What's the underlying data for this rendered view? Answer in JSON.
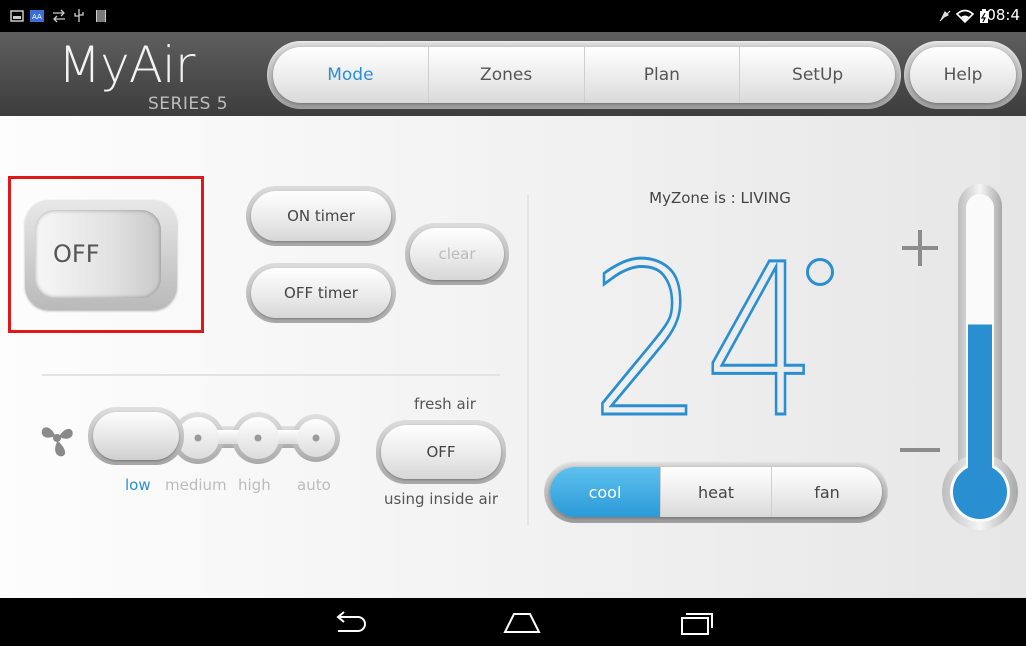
{
  "status_bar": {
    "time": "08:4",
    "left_icons": [
      "image-icon",
      "a-icon",
      "swap-icon",
      "usb-icon",
      "bars-icon"
    ],
    "right_icons": [
      "mute-icon",
      "wifi-icon",
      "battery-icon"
    ]
  },
  "header": {
    "logo": "MyAir",
    "logo_sub": "SERIES 5",
    "tabs": [
      {
        "label": "Mode",
        "active": true
      },
      {
        "label": "Zones",
        "active": false
      },
      {
        "label": "Plan",
        "active": false
      },
      {
        "label": "SetUp",
        "active": false
      }
    ],
    "help_label": "Help"
  },
  "power": {
    "label": "OFF",
    "state": "off"
  },
  "timers": {
    "on_label": "ON timer",
    "off_label": "OFF timer",
    "clear_label": "clear"
  },
  "fan_speed": {
    "options": [
      "low",
      "medium",
      "high",
      "auto"
    ],
    "selected": "low"
  },
  "fresh_air": {
    "title": "fresh air",
    "button_label": "OFF",
    "status": "using inside air"
  },
  "temperature": {
    "zone_text": "MyZone is : LIVING",
    "value": "24",
    "unit_symbol": "°",
    "plus_label": "+",
    "minus_label": "−",
    "level_fraction": 0.55
  },
  "mode_select": {
    "options": [
      {
        "label": "cool",
        "active": true
      },
      {
        "label": "heat",
        "active": false
      },
      {
        "label": "fan",
        "active": false
      }
    ]
  },
  "colors": {
    "accent": "#2a8fd0",
    "highlight": "#e01818"
  },
  "nav_buttons": [
    "back-icon",
    "home-icon",
    "recents-icon"
  ]
}
